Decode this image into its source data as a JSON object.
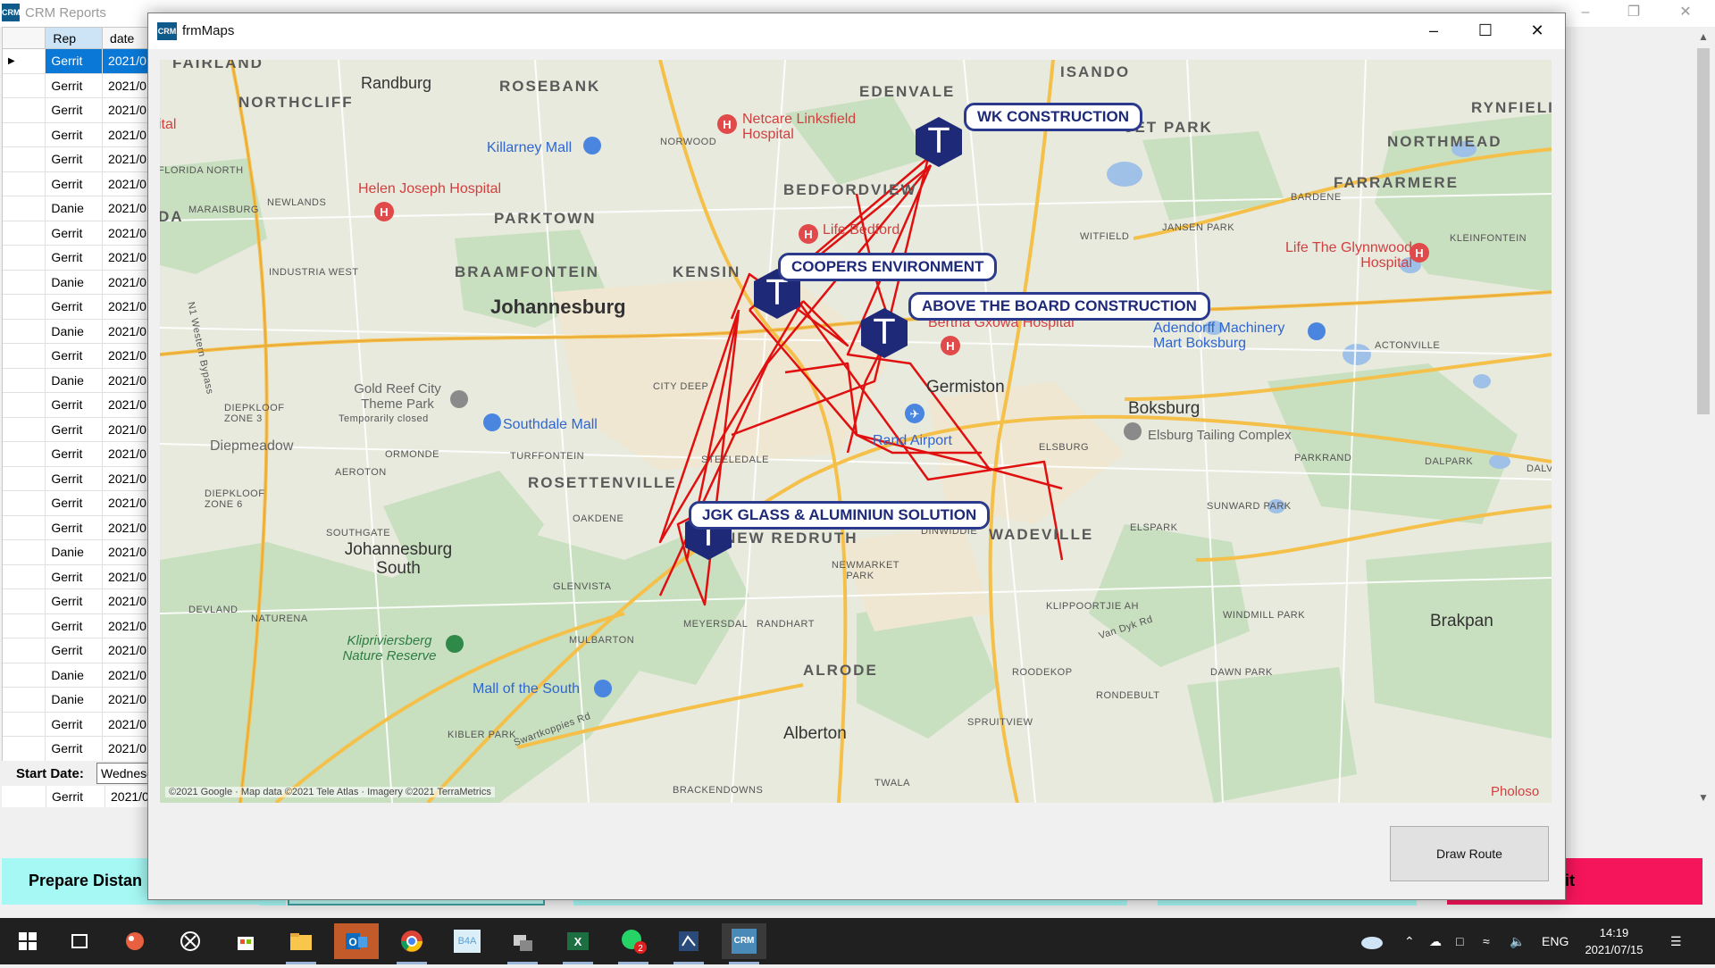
{
  "crm": {
    "title": "CRM Reports",
    "icon": "CRM",
    "grid": {
      "columns": [
        "",
        "Rep",
        "date"
      ],
      "rows": [
        {
          "rep": "Gerrit",
          "date": "2021/0"
        },
        {
          "rep": "Gerrit",
          "date": "2021/0"
        },
        {
          "rep": "Gerrit",
          "date": "2021/0"
        },
        {
          "rep": "Gerrit",
          "date": "2021/0"
        },
        {
          "rep": "Gerrit",
          "date": "2021/0"
        },
        {
          "rep": "Gerrit",
          "date": "2021/0"
        },
        {
          "rep": "Danie",
          "date": "2021/0"
        },
        {
          "rep": "Gerrit",
          "date": "2021/0"
        },
        {
          "rep": "Gerrit",
          "date": "2021/0"
        },
        {
          "rep": "Danie",
          "date": "2021/0"
        },
        {
          "rep": "Gerrit",
          "date": "2021/0"
        },
        {
          "rep": "Danie",
          "date": "2021/0"
        },
        {
          "rep": "Gerrit",
          "date": "2021/0"
        },
        {
          "rep": "Danie",
          "date": "2021/0"
        },
        {
          "rep": "Gerrit",
          "date": "2021/0"
        },
        {
          "rep": "Gerrit",
          "date": "2021/0"
        },
        {
          "rep": "Gerrit",
          "date": "2021/0"
        },
        {
          "rep": "Gerrit",
          "date": "2021/0"
        },
        {
          "rep": "Gerrit",
          "date": "2021/0"
        },
        {
          "rep": "Gerrit",
          "date": "2021/0"
        },
        {
          "rep": "Danie",
          "date": "2021/0"
        },
        {
          "rep": "Gerrit",
          "date": "2021/0"
        },
        {
          "rep": "Gerrit",
          "date": "2021/0"
        },
        {
          "rep": "Gerrit",
          "date": "2021/0"
        },
        {
          "rep": "Gerrit",
          "date": "2021/0"
        },
        {
          "rep": "Danie",
          "date": "2021/0"
        },
        {
          "rep": "Danie",
          "date": "2021/0"
        },
        {
          "rep": "Gerrit",
          "date": "2021/0"
        },
        {
          "rep": "Gerrit",
          "date": "2021/0"
        }
      ],
      "last_row": {
        "rep": "Gerrit",
        "date": "2021/0"
      }
    },
    "start_date_label": "Start Date:",
    "start_date_value": "Wednesd",
    "prepare_button": "Prepare Distan",
    "exit_button": "Exit"
  },
  "dialog": {
    "title": "frmMaps",
    "icon": "CRM",
    "draw_route_button": "Draw Route",
    "map": {
      "callouts": [
        {
          "label": "WK CONSTRUCTION"
        },
        {
          "label": "COOPERS ENVIRONMENT"
        },
        {
          "label": "ABOVE THE BOARD CONSTRUCTION"
        },
        {
          "label": "JGK GLASS & ALUMINIUN SOLUTION"
        }
      ],
      "marker_letter": "T",
      "places": {
        "fairland": "FAIRLAND",
        "randburg": "Randburg",
        "rosebank": "ROSEBANK",
        "edenvale": "EDENVALE",
        "isando": "ISANDO",
        "rynfield": "RYNFIELI",
        "northcliff": "NORTHCLIFF",
        "netcare": "Netcare Linksfield Hospital",
        "killarney": "Killarney Mall",
        "norwood": "NORWOOD",
        "jet_park": "JET PARK",
        "northmead": "NORTHMEAD",
        "florida_north": "FLORIDA NORTH",
        "helen_joseph": "Helen Joseph Hospital",
        "bedfordview": "BEDFORDVIEW",
        "farrarmere": "FARRARMERE",
        "maraisburg": "MARAISBURG",
        "newlands": "NEWLANDS",
        "parktown": "PARKTOWN",
        "bardene": "BARDENE",
        "life_bedford": "Life Bedford",
        "witfield": "WITFIELD",
        "jansen_park": "JANSEN PARK",
        "kleinfontein": "KLEINFONTEIN",
        "life_glynnwood": "Life The Glynnwood Hospital",
        "industria_west": "INDUSTRIA WEST",
        "braamfontein": "BRAAMFONTEIN",
        "kensington": "KENSIN",
        "johannesburg": "Johannesburg",
        "bertha": "Bertha Gxowa Hospital",
        "adendorff": "Adendorff Machinery Mart Boksburg",
        "actonville": "ACTONVILLE",
        "city_deep": "CITY DEEP",
        "germiston": "Germiston",
        "gold_reef": "Gold Reef City Theme Park",
        "temp_closed": "Temporarily closed",
        "diepkloof3": "DIEPKLOOF ZONE 3",
        "southdale": "Southdale Mall",
        "boksburg": "Boksburg",
        "elsburg_tailing": "Elsburg Tailing Complex",
        "diepmeadow": "Diepmeadow",
        "ormonde": "ORMONDE",
        "turffontein": "TURFFONTEIN",
        "rand_airport": "Rand Airport",
        "elsburg": "ELSBURG",
        "parkrand": "PARKRAND",
        "dalpark": "DALPARK",
        "aeroton": "AEROTON",
        "steeledale": "STEELEDALE",
        "rosettenville": "ROSETTENVILLE",
        "diepkloof6": "DIEPKLOOF ZONE 6",
        "oakdene": "OAKDENE",
        "new_redruth": "NEW REDRUTH",
        "dinwiddie": "DINWIDDIE",
        "wadeville": "WADEVILLE",
        "elspark": "ELSPARK",
        "sunward_park": "SUNWARD PARK",
        "southgate": "SOUTHGATE",
        "jhb_south": "Johannesburg South",
        "newmarket": "NEWMARKET PARK",
        "glenvista": "GLENVISTA",
        "devland": "DEVLAND",
        "naturena": "NATURENA",
        "meyersdal": "MEYERSDAL",
        "randhart": "RANDHART",
        "klippoortjie": "KLIPPOORTJIE AH",
        "windmill_park": "WINDMILL PARK",
        "brakpan": "Brakpan",
        "klipriviersberg": "Klipriviersberg Nature Reserve",
        "mulbarton": "MULBARTON",
        "alrode": "ALRODE",
        "roodekop": "ROODEKOP",
        "van_dyk": "Van Dyk Rd",
        "dawn_park": "DAWN PARK",
        "mall_south": "Mall of the South",
        "rondebult": "RONDEBULT",
        "spruitview": "SPRUITVIEW",
        "kibler_park": "KIBLER PARK",
        "swartkoppies": "Swartkoppies Rd",
        "alberton": "Alberton",
        "brackendowns": "BRACKENDOWNS",
        "twala": "TWALA",
        "nw_bypass": "N1 Western Bypass",
        "ital": "ital",
        "da": "DA",
        "daly": "DALV",
        "phol": "Pholoso"
      },
      "copyright": "©2021 Google · Map data ©2021 Tele Atlas · Imagery ©2021 TerraMetrics"
    }
  },
  "taskbar": {
    "lang": "ENG",
    "time": "14:19",
    "date": "2021/07/15",
    "whatsapp_badge": "2",
    "b4a": "B4A",
    "crm": "CRM"
  }
}
